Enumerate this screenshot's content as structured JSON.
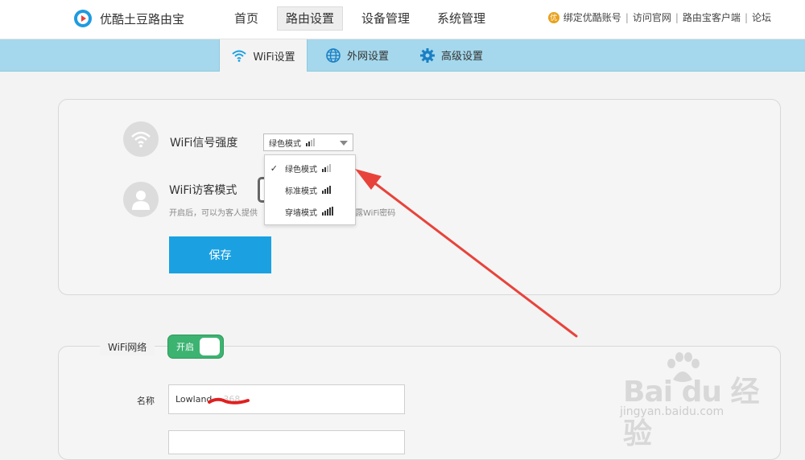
{
  "header": {
    "brand": "优酷土豆路由宝",
    "nav": [
      {
        "label": "首页",
        "active": false
      },
      {
        "label": "路由设置",
        "active": true
      },
      {
        "label": "设备管理",
        "active": false
      },
      {
        "label": "系统管理",
        "active": false
      }
    ],
    "badge": "优",
    "links": [
      "绑定优酷账号",
      "访问官网",
      "路由宝客户端",
      "论坛"
    ]
  },
  "subnav": {
    "tabs": [
      {
        "label": "WiFi设置",
        "icon": "wifi-icon",
        "active": true
      },
      {
        "label": "外网设置",
        "icon": "globe-icon",
        "active": false
      },
      {
        "label": "高级设置",
        "icon": "gear-icon",
        "active": false
      }
    ]
  },
  "signal": {
    "label": "WiFi信号强度",
    "selected": "绿色模式",
    "options": [
      {
        "label": "绿色模式",
        "checked": true,
        "level": 2
      },
      {
        "label": "标准模式",
        "checked": false,
        "level": 4
      },
      {
        "label": "穿墙模式",
        "checked": false,
        "level": 5
      }
    ]
  },
  "guest": {
    "label": "WiFi访客模式",
    "hint_left": "开启后，可以为客人提供",
    "hint_right": "露WiFi密码"
  },
  "save_label": "保存",
  "network": {
    "legend": "WiFi网络",
    "toggle_label": "开启",
    "name_label": "名称",
    "name_value": "Lowland",
    "name_suffix": "368"
  },
  "watermark": {
    "brand": "Bai du 经验",
    "url": "jingyan.baidu.com"
  },
  "colors": {
    "accent": "#1ba1e2",
    "subnav": "#a5d8ec",
    "toggle": "#3cb371",
    "arrow": "#e8433b"
  }
}
